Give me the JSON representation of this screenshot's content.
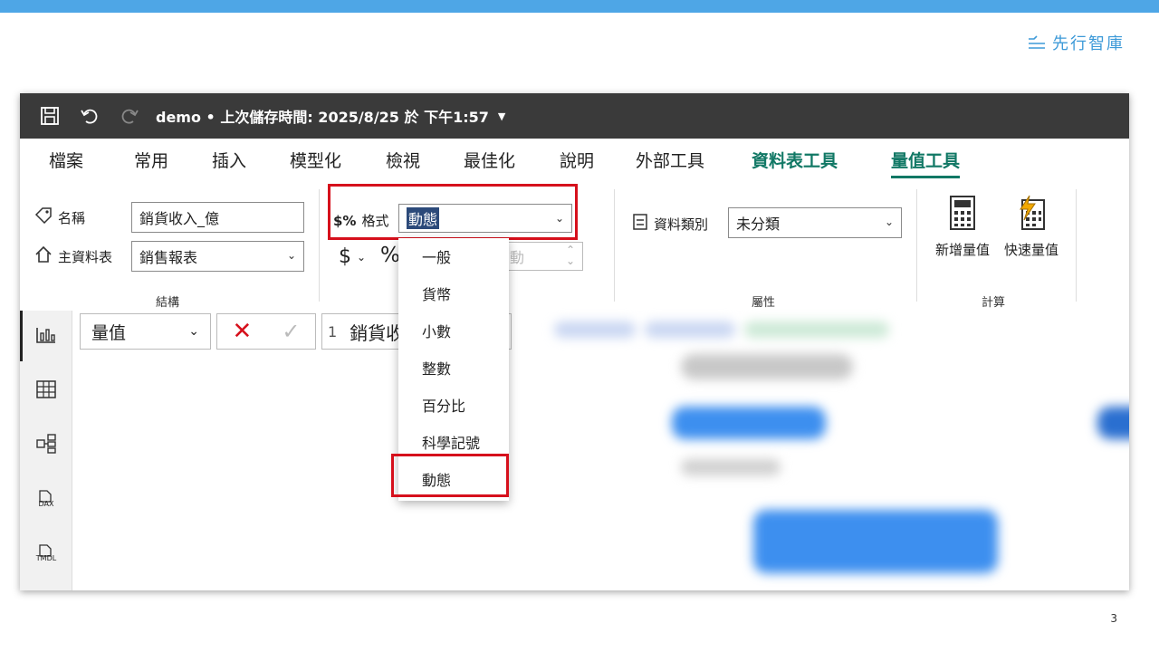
{
  "brand": {
    "name": "先行智庫"
  },
  "page_number": "3",
  "window": {
    "title": "demo • 上次儲存時間: 2025/8/25 於 下午1:57"
  },
  "tabs": [
    {
      "label": "檔案"
    },
    {
      "label": "常用"
    },
    {
      "label": "插入"
    },
    {
      "label": "模型化"
    },
    {
      "label": "檢視"
    },
    {
      "label": "最佳化"
    },
    {
      "label": "說明"
    },
    {
      "label": "外部工具"
    },
    {
      "label": "資料表工具"
    },
    {
      "label": "量值工具"
    }
  ],
  "structure_group": {
    "name_label": "名稱",
    "name_value": "銷貨收入_億",
    "home_table_label": "主資料表",
    "home_table_value": "銷售報表",
    "group_label": "結構"
  },
  "format_group": {
    "format_label": "格式",
    "format_value": "動態",
    "currency_symbol": "$",
    "percent_symbol": "%",
    "decimal_value": "動"
  },
  "properties_group": {
    "data_category_label": "資料類別",
    "data_category_value": "未分類",
    "group_label": "屬性"
  },
  "calculations_group": {
    "new_measure_label": "新增量值",
    "quick_measure_label": "快速量值",
    "group_label": "計算"
  },
  "format_dropdown": {
    "options": [
      "一般",
      "貨幣",
      "小數",
      "整數",
      "百分比",
      "科學記號",
      "動態"
    ],
    "selected": "動態"
  },
  "formula_bar": {
    "field_selector": "量值",
    "line_number": "1",
    "expression": "銷貨收"
  },
  "rail": {
    "dax_label": "DAX",
    "tmdl_label": "TMDL"
  },
  "colors": {
    "accent_blue": "#4ea6e6",
    "highlight_red": "#d6101c",
    "tool_green": "#117865"
  }
}
